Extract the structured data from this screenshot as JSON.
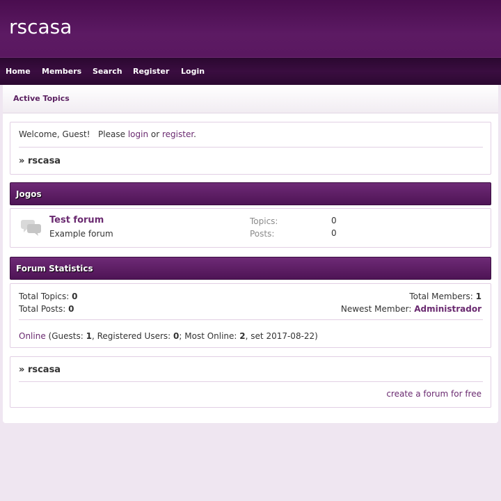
{
  "site": {
    "title": "rscasa"
  },
  "nav": {
    "items": [
      "Home",
      "Members",
      "Search",
      "Register",
      "Login"
    ]
  },
  "subnav": {
    "active_topics": "Active Topics"
  },
  "welcome": {
    "prefix": "Welcome, Guest!",
    "please": "Please",
    "login": "login",
    "or": "or",
    "register": "register",
    "period": ".",
    "breadcrumb_sep": "»",
    "breadcrumb_site": "rscasa"
  },
  "category": {
    "title": "Jogos",
    "forums": [
      {
        "name": "Test forum",
        "description": "Example forum",
        "topics_label": "Topics:",
        "topics": "0",
        "posts_label": "Posts:",
        "posts": "0",
        "icon": "forum-bubbles-icon"
      }
    ]
  },
  "stats": {
    "title": "Forum Statistics",
    "total_topics_label": "Total Topics:",
    "total_topics": "0",
    "total_posts_label": "Total Posts:",
    "total_posts": "0",
    "total_members_label": "Total Members:",
    "total_members": "1",
    "newest_member_label": "Newest Member:",
    "newest_member": "Administrador",
    "online_link": "Online",
    "online_guests_label": "(Guests:",
    "online_guests": "1",
    "online_registered_label": ", Registered Users:",
    "online_registered": "0",
    "online_most_label": "; Most Online:",
    "online_most": "2",
    "online_most_date": ", set 2017-08-22)"
  },
  "footer": {
    "breadcrumb_sep": "»",
    "breadcrumb_site": "rscasa",
    "create_link": "create a forum for free"
  },
  "colors": {
    "brand": "#5a1860",
    "nav_bg": "#2b0830",
    "link": "#6a2a70",
    "page_bg": "#efe6f1"
  }
}
